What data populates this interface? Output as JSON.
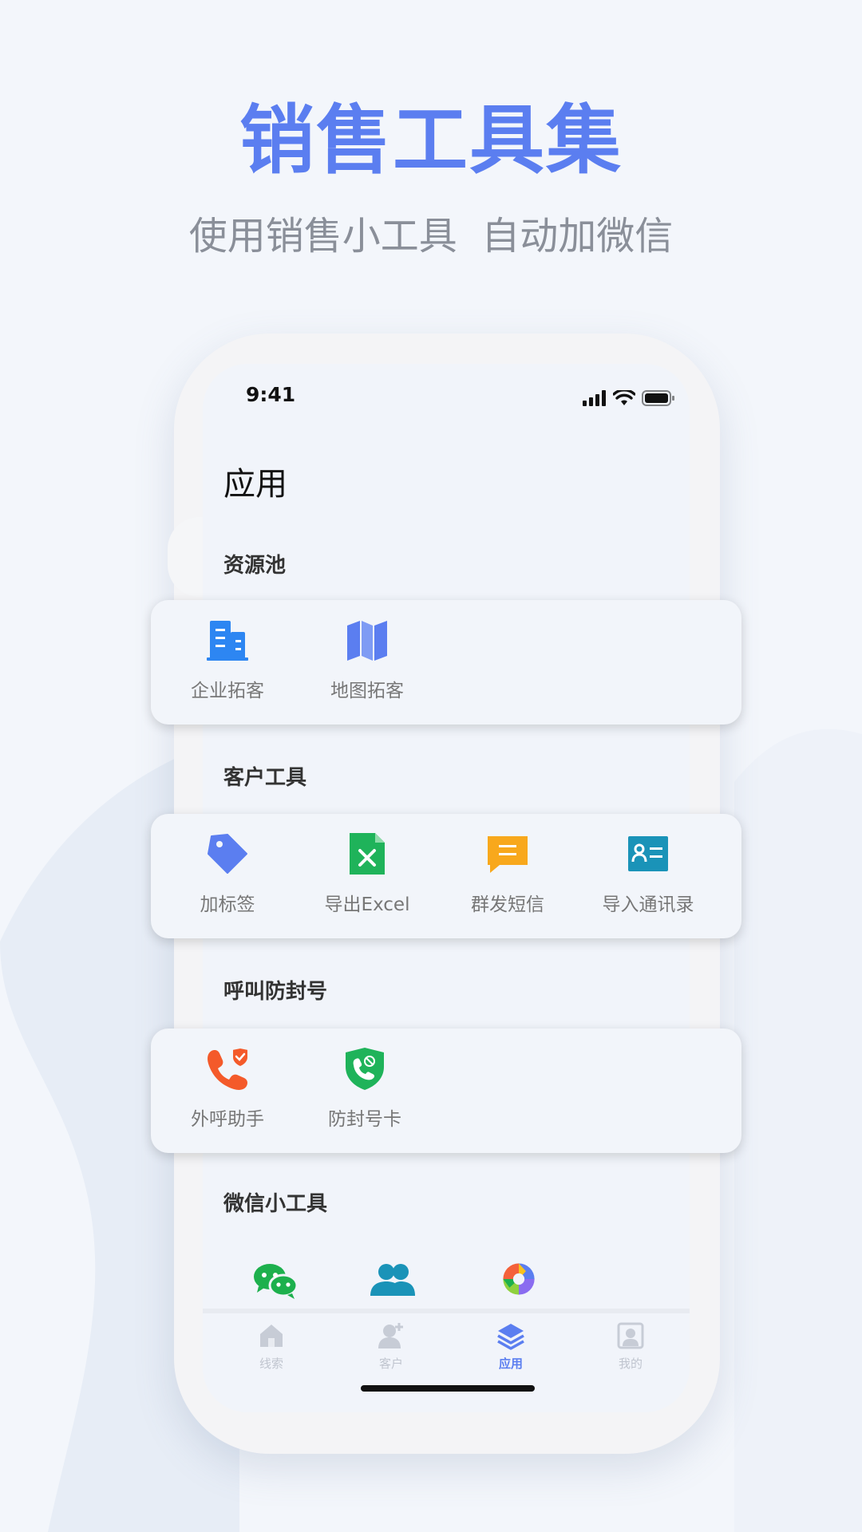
{
  "hero": {
    "title": "销售工具集",
    "subtitle": "使用销售小工具  自动加微信"
  },
  "status_bar": {
    "time": "9:41"
  },
  "app": {
    "title": "应用",
    "sections": [
      {
        "label": "资源池",
        "tools": [
          {
            "label": "企业拓客",
            "icon": "building-icon"
          },
          {
            "label": "地图拓客",
            "icon": "map-icon"
          }
        ]
      },
      {
        "label": "客户工具",
        "tools": [
          {
            "label": "加标签",
            "icon": "tag-icon"
          },
          {
            "label": "导出Excel",
            "icon": "excel-icon"
          },
          {
            "label": "群发短信",
            "icon": "message-icon"
          },
          {
            "label": "导入通讯录",
            "icon": "contact-card-icon"
          }
        ]
      },
      {
        "label": "呼叫防封号",
        "tools": [
          {
            "label": "外呼助手",
            "icon": "phone-check-icon"
          },
          {
            "label": "防封号卡",
            "icon": "phone-shield-icon"
          }
        ]
      },
      {
        "label": "微信小工具",
        "tools": [
          {
            "icon": "wechat-icon"
          },
          {
            "icon": "group-icon"
          },
          {
            "icon": "moments-icon"
          }
        ]
      }
    ]
  },
  "tabbar": {
    "tabs": [
      {
        "label": "线索",
        "icon": "home-icon",
        "active": false
      },
      {
        "label": "客户",
        "icon": "add-user-icon",
        "active": false
      },
      {
        "label": "应用",
        "icon": "layers-icon",
        "active": true
      },
      {
        "label": "我的",
        "icon": "profile-icon",
        "active": false
      }
    ]
  },
  "colors": {
    "accent": "#5b7ef0",
    "subtitle": "#8a8f99",
    "excel_green": "#1fb35a",
    "message_orange": "#f8a81c",
    "contact_teal": "#1a93b8",
    "call_orange": "#f45a2a",
    "wechat_green": "#1db04d"
  }
}
